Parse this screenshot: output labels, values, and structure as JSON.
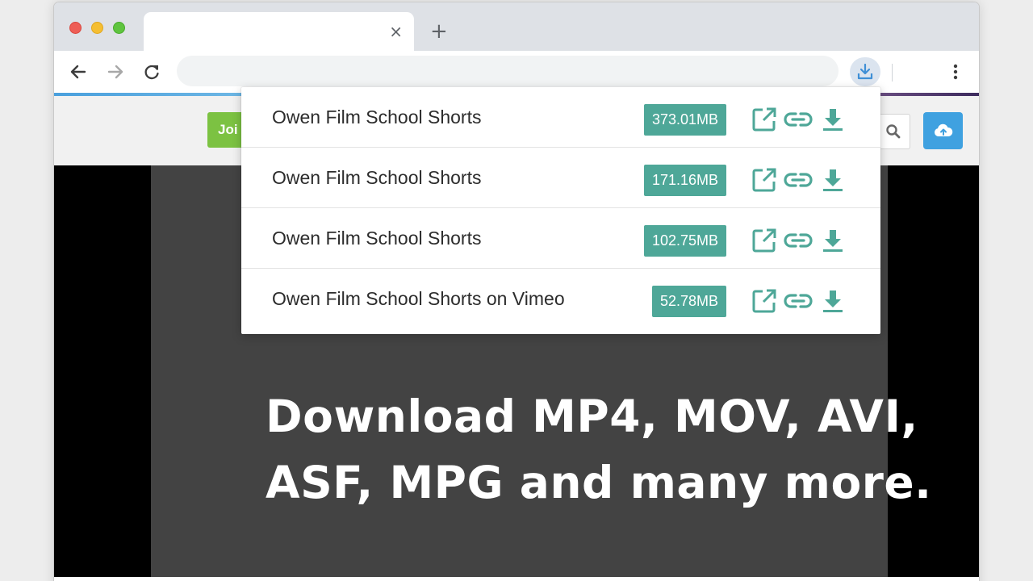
{
  "browser": {
    "tab_close": "×",
    "new_tab": "+"
  },
  "site": {
    "join_label": "Joi"
  },
  "downloads": [
    {
      "title": "Owen Film School Shorts",
      "size": "373.01MB"
    },
    {
      "title": "Owen Film School Shorts",
      "size": "171.16MB"
    },
    {
      "title": "Owen Film School Shorts",
      "size": "102.75MB"
    },
    {
      "title": "Owen Film School Shorts on Vimeo",
      "size": "52.78MB"
    }
  ],
  "caption": {
    "line1": "Download MP4, MOV, AVI,",
    "line2": "ASF, MPG and many more."
  },
  "colors": {
    "accent": "#4ea798",
    "join": "#7cc242",
    "upload": "#3fa1e0"
  },
  "icons": [
    "back-arrow-icon",
    "forward-arrow-icon",
    "reload-icon",
    "download-extension-icon",
    "kebab-menu-icon",
    "search-icon",
    "cloud-upload-icon",
    "open-external-icon",
    "link-icon",
    "download-icon"
  ]
}
